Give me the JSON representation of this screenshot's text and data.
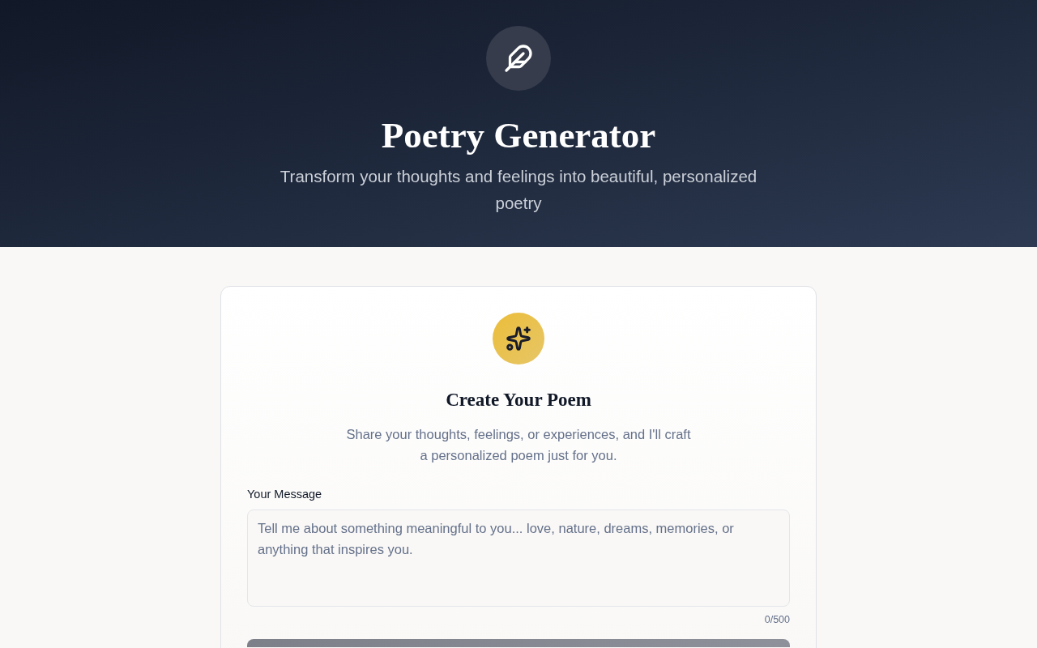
{
  "header": {
    "title": "Poetry Generator",
    "subtitle": "Transform your thoughts and feelings into beautiful, personalized poetry"
  },
  "card": {
    "title": "Create Your Poem",
    "description": "Share your thoughts, feelings, or experiences, and I'll craft a personalized poem just for you.",
    "message_field": {
      "label": "Your Message",
      "placeholder": "Tell me about something meaningful to you... love, nature, dreams, memories, or anything that inspires you.",
      "counter": "0/500"
    },
    "generate_button": {
      "disabled": true
    }
  }
}
